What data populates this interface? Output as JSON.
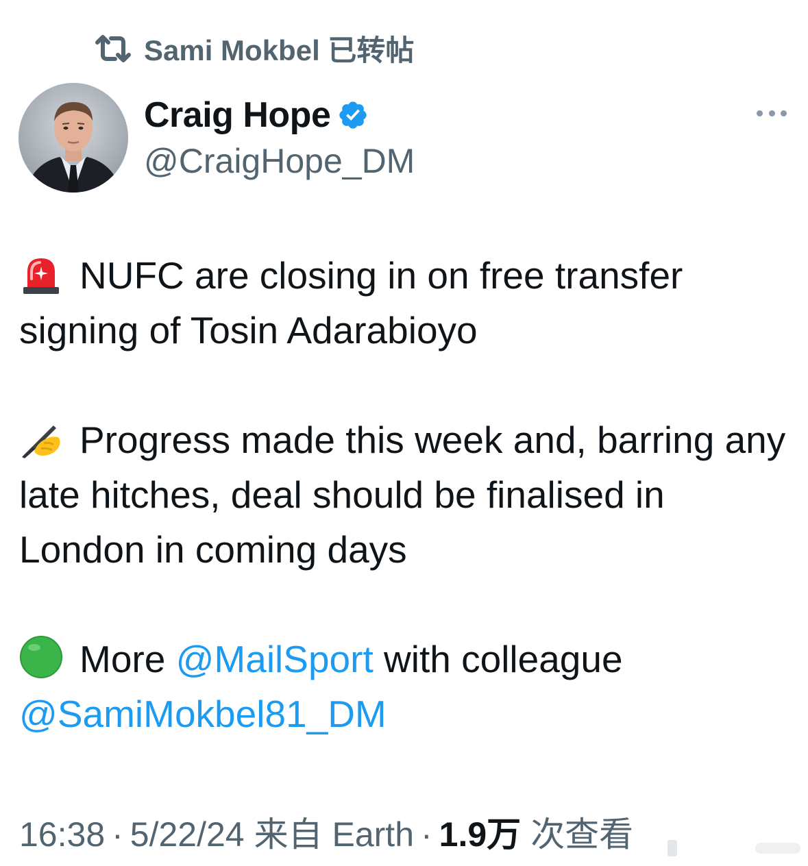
{
  "repost": {
    "icon": "repost-icon",
    "text": "Sami Mokbel 已转帖"
  },
  "author": {
    "display_name": "Craig Hope",
    "handle": "@CraigHope_DM",
    "verified": true,
    "verified_icon": "verified-badge-icon",
    "avatar": "avatar"
  },
  "more_icon": "more-horizontal-icon",
  "tweet": {
    "para1": {
      "emoji": "rotating-light-icon",
      "text_line1": "NUFC are closing in on free transfer",
      "text_line2": "signing of Tosin Adarabioyo"
    },
    "para2": {
      "emoji": "writing-hand-icon",
      "text": "Progress made this week and, barring any late hitches, deal should be finalised in London in coming days"
    },
    "para3": {
      "emoji": "green-circle-icon",
      "prefix": "More",
      "mention1": "@MailSport",
      "middle": "with colleague",
      "mention2": "@SamiMokbel81_DM"
    }
  },
  "meta": {
    "time": "16:38",
    "dot1": "·",
    "date": "5/22/24",
    "source": "来自 Earth",
    "dot2": "·",
    "views_count": "1.9万",
    "views_label": "次查看"
  },
  "colors": {
    "text": "#0f1419",
    "secondary": "#536471",
    "link": "#1d9bf0",
    "verified": "#1d9bf0"
  }
}
